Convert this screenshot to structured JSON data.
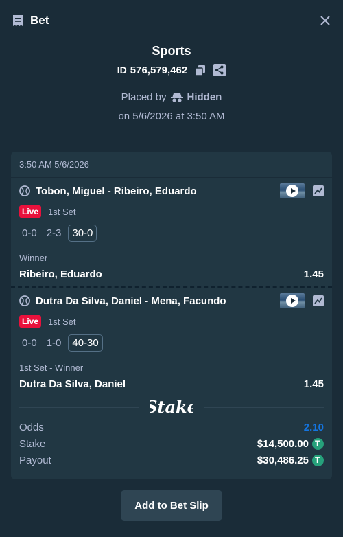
{
  "header": {
    "title": "Bet"
  },
  "summary": {
    "category": "Sports",
    "id_label": "ID",
    "id_value": "576,579,462",
    "placed_by_label": "Placed by",
    "placed_by_user": "Hidden",
    "placed_date": "on 5/6/2026 at 3:50 AM"
  },
  "card": {
    "timestamp": "3:50 AM 5/6/2026",
    "events": [
      {
        "title": "Tobon, Miguel - Ribeiro, Eduardo",
        "live_badge": "Live",
        "period": "1st Set",
        "scores": [
          "0-0",
          "2-3",
          "30-0"
        ],
        "market": "Winner",
        "selection": "Ribeiro, Eduardo",
        "odds": "1.45"
      },
      {
        "title": "Dutra Da Silva, Daniel - Mena, Facundo",
        "live_badge": "Live",
        "period": "1st Set",
        "scores": [
          "0-0",
          "1-0",
          "40-30"
        ],
        "market": "1st Set - Winner",
        "selection": "Dutra Da Silva, Daniel",
        "odds": "1.45"
      }
    ],
    "footer": {
      "logo_text": "Stake",
      "odds_label": "Odds",
      "odds_value": "2.10",
      "stake_label": "Stake",
      "stake_value": "$14,500.00",
      "payout_label": "Payout",
      "payout_value": "$30,486.25",
      "currency_icon": "tether-icon"
    }
  },
  "button": {
    "label": "Add to Bet Slip"
  },
  "colors": {
    "bg": "#1a2c38",
    "card": "#213743",
    "live": "#e9113c",
    "odds": "#1475e1",
    "tether": "#26a17b"
  }
}
